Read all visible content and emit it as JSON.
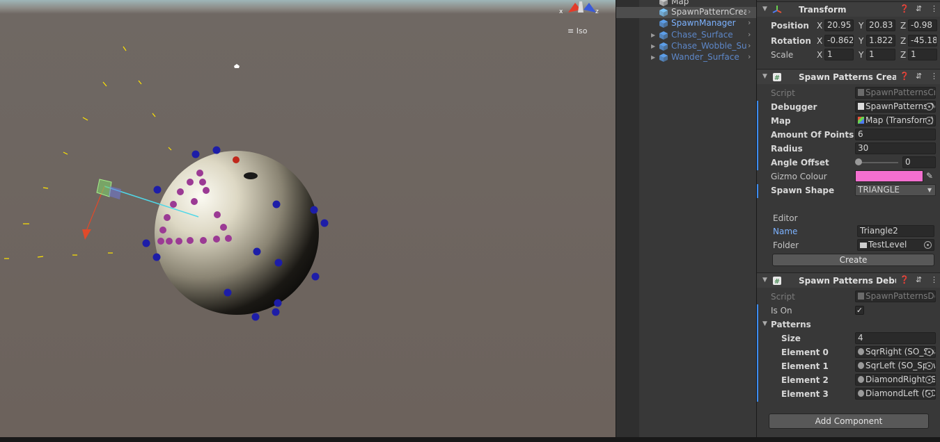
{
  "scene": {
    "iso_label": "Iso",
    "gizmo_axes": {
      "x": "x",
      "z": "z"
    }
  },
  "hierarchy": {
    "items": [
      {
        "label": "Map",
        "style": "white",
        "fold": false,
        "selected": false
      },
      {
        "label": "SpawnPatternCreator",
        "style": "white",
        "fold": false,
        "selected": true,
        "arrow": true
      },
      {
        "label": "SpawnManager",
        "style": "blue",
        "fold": false,
        "selected": false,
        "arrow": true
      },
      {
        "label": "Chase_Surface",
        "style": "dim",
        "fold": true,
        "selected": false,
        "arrow": true
      },
      {
        "label": "Chase_Wobble_Surface",
        "style": "dim",
        "fold": true,
        "selected": false,
        "arrow": true
      },
      {
        "label": "Wander_Surface",
        "style": "dim",
        "fold": true,
        "selected": false,
        "arrow": true
      }
    ]
  },
  "inspector": {
    "transform": {
      "title": "Transform",
      "position_label": "Position",
      "rotation_label": "Rotation",
      "scale_label": "Scale",
      "position": {
        "x": "20.95",
        "y": "20.83",
        "z": "-0.98"
      },
      "rotation": {
        "x": "-0.862",
        "y": "1.822",
        "z": "-45.18"
      },
      "scale": {
        "x": "1",
        "y": "1",
        "z": "1"
      }
    },
    "creator": {
      "title": "Spawn Patterns Creator",
      "script_label": "Script",
      "script_value": "SpawnPatternsCreator",
      "debugger_label": "Debugger",
      "debugger_value": "SpawnPatternsDebugger",
      "map_label": "Map",
      "map_value": "Map (Transform)",
      "amount_label": "Amount Of Points",
      "amount_value": "6",
      "radius_label": "Radius",
      "radius_value": "30",
      "angle_label": "Angle Offset",
      "angle_value": "0",
      "angle_fraction": 0,
      "gizmo_label": "Gizmo Colour",
      "gizmo_color": "#f46fd0",
      "shape_label": "Spawn Shape",
      "shape_value": "TRIANGLE",
      "editor_header": "Editor",
      "name_label": "Name",
      "name_value": "Triangle2",
      "folder_label": "Folder",
      "folder_value": "TestLevel",
      "create_button": "Create"
    },
    "debugger": {
      "title": "Spawn Patterns Debugger",
      "script_label": "Script",
      "script_value": "SpawnPatternsDebugger",
      "ison_label": "Is On",
      "ison_checked": true,
      "patterns_label": "Patterns",
      "size_label": "Size",
      "size_value": "4",
      "elements": [
        {
          "label": "Element 0",
          "value": "SqrRight (SO_SpawnPattern)"
        },
        {
          "label": "Element 1",
          "value": "SqrLeft (SO_SpawnPattern)"
        },
        {
          "label": "Element 2",
          "value": "DiamondRight (SO_SpawnPattern)"
        },
        {
          "label": "Element 3",
          "value": "DiamondLeft (SO_SpawnPattern)"
        }
      ]
    },
    "add_component": "Add Component"
  },
  "colors": {
    "accent": "#3c8cf0",
    "blue_dots": "#1d1da8",
    "purple_dots": "#9b3a94",
    "yellow_marks": "#ffe400"
  }
}
